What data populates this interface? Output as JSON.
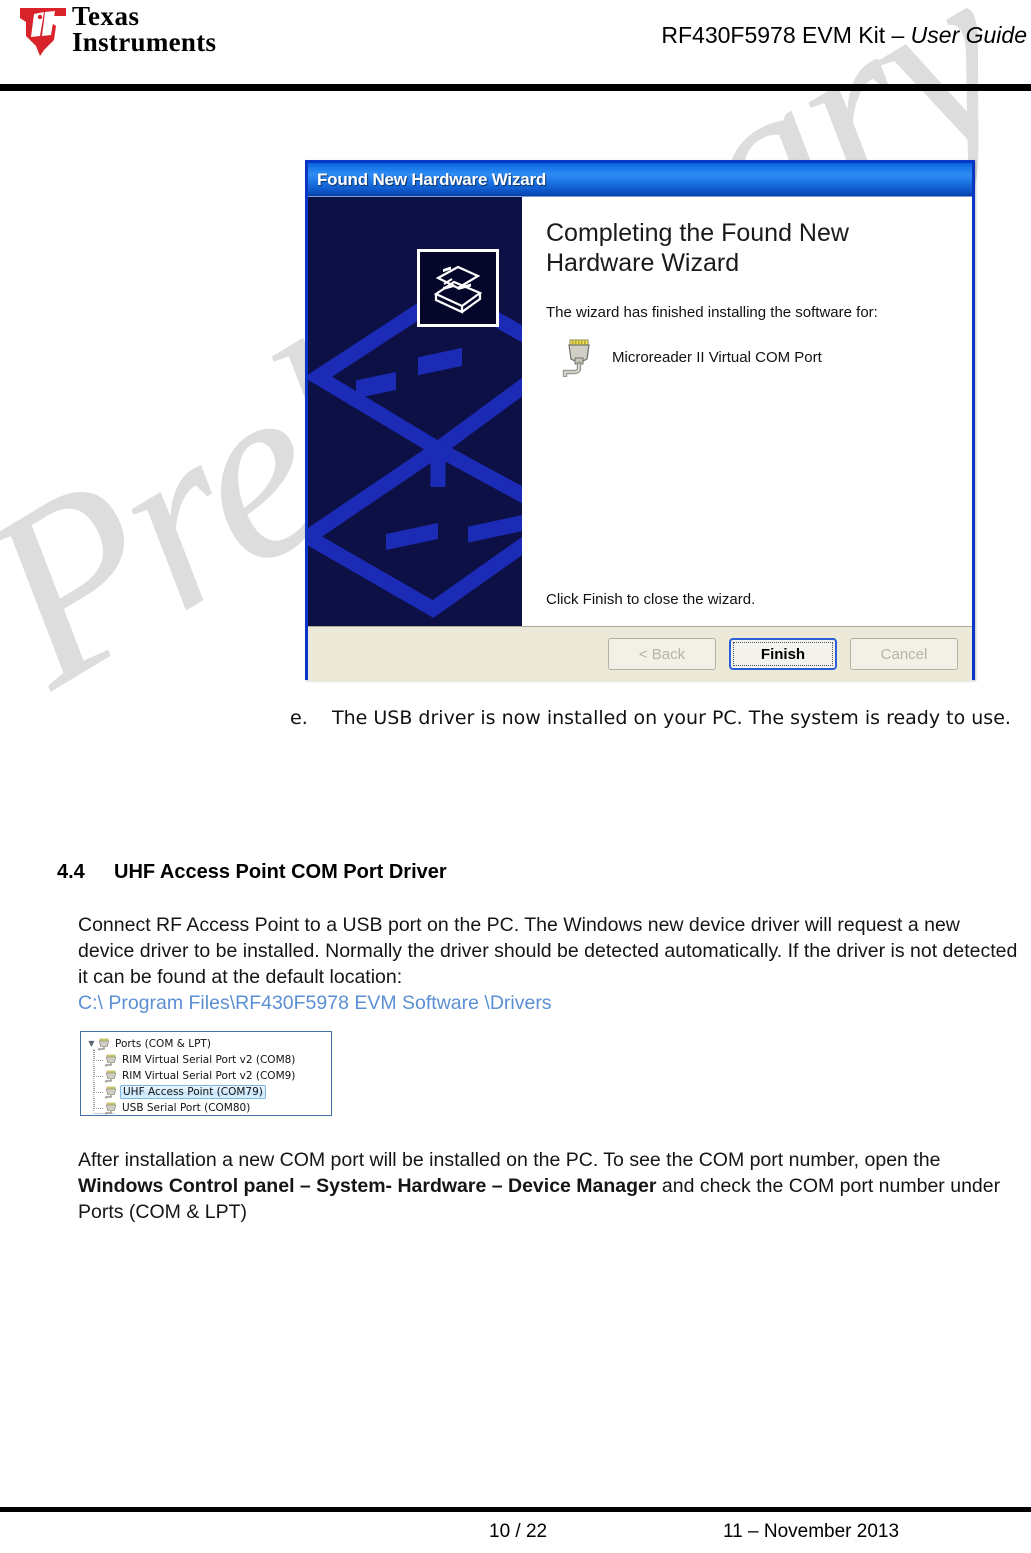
{
  "header": {
    "logo_alt": "Texas Instruments",
    "logo_line1": "Texas",
    "logo_line2": "Instruments",
    "title_main": "RF430F5978 EVM Kit – ",
    "title_italic": "User Guide"
  },
  "watermark": {
    "text": "Preliminary"
  },
  "wizard": {
    "titlebar": "Found New Hardware Wizard",
    "heading": "Completing the Found New Hardware Wizard",
    "subtitle": "The wizard has finished installing the software for:",
    "device_name": "Microreader II Virtual COM Port",
    "device_icon": "serial-port-icon",
    "side_icon": "hardware-device-icon",
    "closing_text": "Click Finish to close the wizard.",
    "buttons": {
      "back": "< Back",
      "back_accel_pre": "< ",
      "back_accel": "B",
      "back_accel_post": "ack",
      "finish": "Finish",
      "cancel": "Cancel"
    },
    "colors": {
      "titlebar_blue": "#1573e8",
      "side_panel": "#0d1045",
      "chrome": "#ece9d8",
      "default_button_border": "#2a5fd6"
    }
  },
  "list_item": {
    "marker": "e.",
    "text": "The USB driver is now installed on your PC. The system is ready to use."
  },
  "section": {
    "number": "4.4",
    "title": "UHF Access Point COM Port Driver",
    "paragraph1": "Connect RF Access Point to a USB port on the PC. The Windows new device driver will request a new device driver to be installed. Normally the driver should be detected automatically. If the driver is not detected it can be found at the default location:",
    "path": "C:\\ Program Files\\RF430F5978 EVM Software \\Drivers",
    "path_color": "#5b8fd4",
    "paragraph2_a": "After installation a new COM port will be installed on the PC. To see the COM port number, open the ",
    "paragraph2_bold": "Windows Control panel – System- Hardware – Device Manager",
    "paragraph2_b": " and check the COM port number under Ports (COM & LPT)"
  },
  "device_tree": {
    "root": {
      "label": "Ports (COM & LPT)",
      "icon": "port-icon",
      "twisty": "expanded"
    },
    "children": [
      {
        "label": "RIM Virtual Serial Port v2 (COM8)",
        "icon": "port-icon",
        "selected": false
      },
      {
        "label": "RIM Virtual Serial Port v2 (COM9)",
        "icon": "port-icon",
        "selected": false
      },
      {
        "label": "UHF Access Point (COM79)",
        "icon": "port-icon",
        "selected": true
      },
      {
        "label": "USB Serial Port (COM80)",
        "icon": "port-icon",
        "selected": false
      }
    ]
  },
  "footer": {
    "page": "10 / 22",
    "date": "11 – November  2013"
  }
}
